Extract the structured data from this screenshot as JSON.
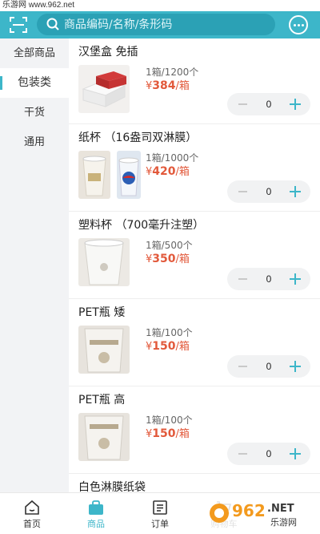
{
  "watermark": {
    "top_text": "乐游网 www.962.net",
    "logo_text": "962.NET",
    "logo_sub": "乐游网"
  },
  "header": {
    "search_placeholder": "商品编码/名称/条形码",
    "icons": [
      "scan-icon",
      "search-icon",
      "message-icon"
    ],
    "accent_color": "#3db6c9"
  },
  "sidebar": {
    "items": [
      {
        "label": "全部商品"
      },
      {
        "label": "包装类",
        "active": true
      },
      {
        "label": "干货"
      },
      {
        "label": "通用"
      }
    ]
  },
  "products": [
    {
      "title": "汉堡盒 免插",
      "spec": "1箱/1200个",
      "price_symbol": "¥",
      "price": "384",
      "unit": "/箱",
      "qty": "0"
    },
    {
      "title": "纸杯 （16盎司双淋膜）",
      "spec": "1箱/1000个",
      "price_symbol": "¥",
      "price": "420",
      "unit": "/箱",
      "qty": "0"
    },
    {
      "title": "塑料杯 （700毫升注塑）",
      "spec": "1箱/500个",
      "price_symbol": "¥",
      "price": "350",
      "unit": "/箱",
      "qty": "0"
    },
    {
      "title": "PET瓶 矮",
      "spec": "1箱/100个",
      "price_symbol": "¥",
      "price": "150",
      "unit": "/箱",
      "qty": "0"
    },
    {
      "title": "PET瓶 高",
      "spec": "1箱/100个",
      "price_symbol": "¥",
      "price": "150",
      "unit": "/箱",
      "qty": "0"
    },
    {
      "title": "白色淋膜纸袋"
    }
  ],
  "tabbar": {
    "items": [
      {
        "label": "首页",
        "icon": "home-icon"
      },
      {
        "label": "商品",
        "icon": "shopping-bag-icon",
        "active": true
      },
      {
        "label": "订单",
        "icon": "order-list-icon"
      },
      {
        "label": "购物车",
        "icon": "cart-icon"
      }
    ]
  }
}
